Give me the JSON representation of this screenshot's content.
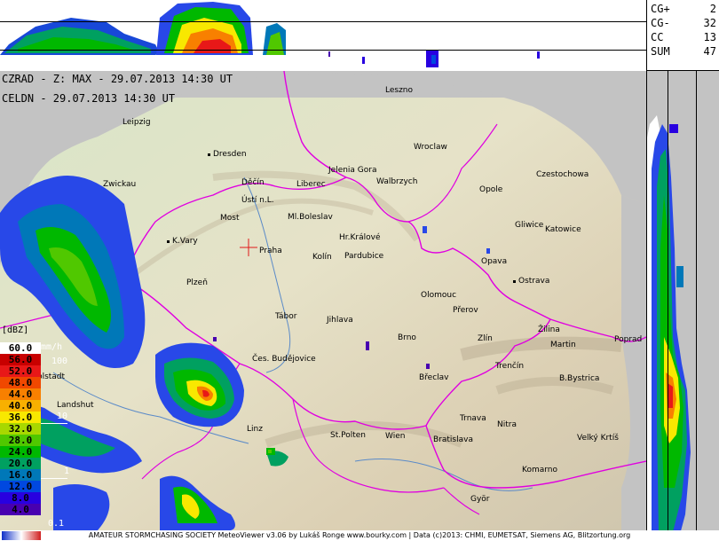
{
  "header": {
    "line1": "CZRAD - Z: MAX - 29.07.2013 14:30 UT",
    "line2": "CELDN - 29.07.2013 14:30 UT"
  },
  "lightning": [
    {
      "label": "CG+",
      "value": "2"
    },
    {
      "label": "CG-",
      "value": "32"
    },
    {
      "label": "CC",
      "value": "13"
    },
    {
      "label": "SUM",
      "value": "47"
    }
  ],
  "legend": {
    "title": "[dBZ]",
    "unit": "mm/h",
    "levels": [
      {
        "value": "60.0",
        "color": "#ffffff",
        "text": "#000000"
      },
      {
        "value": "56.0",
        "color": "#c80000",
        "text": "#000000"
      },
      {
        "value": "52.0",
        "color": "#e81818",
        "text": "#000000"
      },
      {
        "value": "48.0",
        "color": "#f04800",
        "text": "#000000"
      },
      {
        "value": "44.0",
        "color": "#f88000",
        "text": "#000000"
      },
      {
        "value": "40.0",
        "color": "#f8b000",
        "text": "#000000"
      },
      {
        "value": "36.0",
        "color": "#f8e800",
        "text": "#000000"
      },
      {
        "value": "32.0",
        "color": "#a8d800",
        "text": "#000000"
      },
      {
        "value": "28.0",
        "color": "#50c800",
        "text": "#000000"
      },
      {
        "value": "24.0",
        "color": "#00b800",
        "text": "#000000"
      },
      {
        "value": "20.0",
        "color": "#00a060",
        "text": "#000000"
      },
      {
        "value": "16.0",
        "color": "#0078b8",
        "text": "#000000"
      },
      {
        "value": "12.0",
        "color": "#0048e0",
        "text": "#000000"
      },
      {
        "value": "8.0",
        "color": "#2800e0",
        "text": "#000000"
      },
      {
        "value": "4.0",
        "color": "#4800b0",
        "text": "#000000"
      }
    ],
    "rain_ticks": [
      "100",
      "10",
      "1",
      "0.1"
    ]
  },
  "cities": [
    {
      "name": "Leszno"
    },
    {
      "name": "Leipzig"
    },
    {
      "name": "Dresden"
    },
    {
      "name": "Wroclaw"
    },
    {
      "name": "Jelenia Gora"
    },
    {
      "name": "Walbrzych"
    },
    {
      "name": "Czestochowa"
    },
    {
      "name": "Zwickau"
    },
    {
      "name": "Děčín"
    },
    {
      "name": "Liberec"
    },
    {
      "name": "Opole"
    },
    {
      "name": "Ústí n.L."
    },
    {
      "name": "Most"
    },
    {
      "name": "Ml.Boleslav"
    },
    {
      "name": "Gliwice"
    },
    {
      "name": "Katowice"
    },
    {
      "name": "K.Vary"
    },
    {
      "name": "Praha"
    },
    {
      "name": "Hr.Králové"
    },
    {
      "name": "Kolín"
    },
    {
      "name": "Pardubice"
    },
    {
      "name": "Opava"
    },
    {
      "name": "Plzeň"
    },
    {
      "name": "Ostrava"
    },
    {
      "name": "Olomouc"
    },
    {
      "name": "Přerov"
    },
    {
      "name": "Tábor"
    },
    {
      "name": "Jihlava"
    },
    {
      "name": "Žilina"
    },
    {
      "name": "Brno"
    },
    {
      "name": "Zlín"
    },
    {
      "name": "Martin"
    },
    {
      "name": "Poprad"
    },
    {
      "name": "Ingolstadt"
    },
    {
      "name": "Čes. Budějovice"
    },
    {
      "name": "Trenčín"
    },
    {
      "name": "B.Bystrica"
    },
    {
      "name": "Břeclav"
    },
    {
      "name": "Landshut"
    },
    {
      "name": "Trnava"
    },
    {
      "name": "Nitra"
    },
    {
      "name": "Linz"
    },
    {
      "name": "St.Polten"
    },
    {
      "name": "Wien"
    },
    {
      "name": "Bratislava"
    },
    {
      "name": "Velký Krtíš"
    },
    {
      "name": "Komarno"
    },
    {
      "name": "Györ"
    }
  ],
  "footer": {
    "text": "AMATEUR STORMCHASING SOCIETY MeteoViewer v3.06 by Lukáš Ronge www.bourky.com | Data (c)2013: CHMI, EUMETSAT, Siemens AG, Blitzortung.org"
  }
}
